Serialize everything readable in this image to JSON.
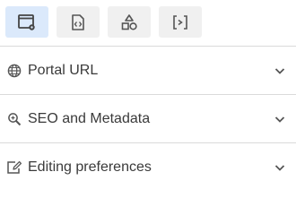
{
  "toolbar": {
    "buttons": [
      {
        "icon": "settings-window-icon",
        "active": true
      },
      {
        "icon": "code-file-icon",
        "active": false
      },
      {
        "icon": "shapes-icon",
        "active": false
      },
      {
        "icon": "code-braces-icon",
        "active": false
      }
    ]
  },
  "sections": [
    {
      "label": "Portal URL",
      "icon": "globe-icon",
      "expanded": false
    },
    {
      "label": "SEO and Metadata",
      "icon": "search-zoom-icon",
      "expanded": false
    },
    {
      "label": "Editing preferences",
      "icon": "edit-window-icon",
      "expanded": false
    }
  ],
  "colors": {
    "active_button_bg": "#dbe9fb",
    "button_bg": "#f0f0f0",
    "icon": "#555555",
    "divider": "#dadada"
  }
}
